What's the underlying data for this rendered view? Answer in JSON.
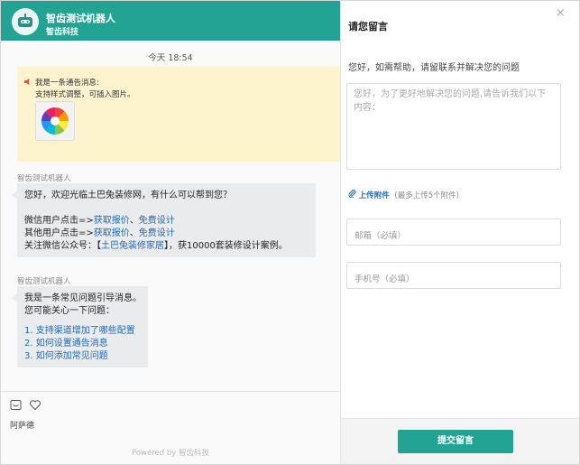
{
  "chat": {
    "bot_name": "智齿测试机器人",
    "company": "智齿科技",
    "time": "今天 18:54",
    "notice": {
      "line1": "我是一条通告消息:",
      "line2": "支持样式调整，可插入图片。"
    },
    "msg1": {
      "sender": "智齿测试机器人",
      "greeting": "您好，欢迎光临土巴兔装修网，有什么可以帮到您？",
      "line2_prefix": "微信用户点击=>",
      "line2_link1": "获取报价",
      "line2_sep": "、",
      "line2_link2": "免费设计",
      "line3_prefix": "其他用户点击=>",
      "line3_link1": "获取报价",
      "line3_sep": "、",
      "line3_link2": "免费设计",
      "line4_prefix": "关注微信公众号：【",
      "line4_link": "土巴兔装修家居",
      "line4_suffix": "】，获10000套装修设计案例。"
    },
    "msg2": {
      "sender": "智齿测试机器人",
      "line1": "我是一条常见问题引导消息。",
      "line2": "您可能关心一下问题：",
      "q1": "1. 支持渠道增加了哪些配置",
      "q2": "2. 如何设置通告消息",
      "q3": "3. 如何添加常见问题"
    },
    "input_text": "阿萨德",
    "powered": "Powered by 智齿科技"
  },
  "message": {
    "title": "请您留言",
    "close": "×",
    "hint": "您好，如需帮助，请留联系并解决您的问题",
    "textarea_placeholder": "您好，为了更好地解决您的问题,请告诉我们以下内容：",
    "upload_label": "上传附件",
    "upload_limit": "(最多上传5个附件)",
    "email_placeholder": "邮箱（必填）",
    "phone_placeholder": "手机号（必填）",
    "submit": "提交留言"
  },
  "colors": {
    "accent": "#23a393",
    "link": "#1f6ab5",
    "notice_bg": "#fdf3cf"
  },
  "icons": [
    "robot-avatar-icon",
    "speaker-icon",
    "color-wheel-image",
    "emoji-icon",
    "heart-icon",
    "paperclip-icon",
    "close-icon"
  ]
}
